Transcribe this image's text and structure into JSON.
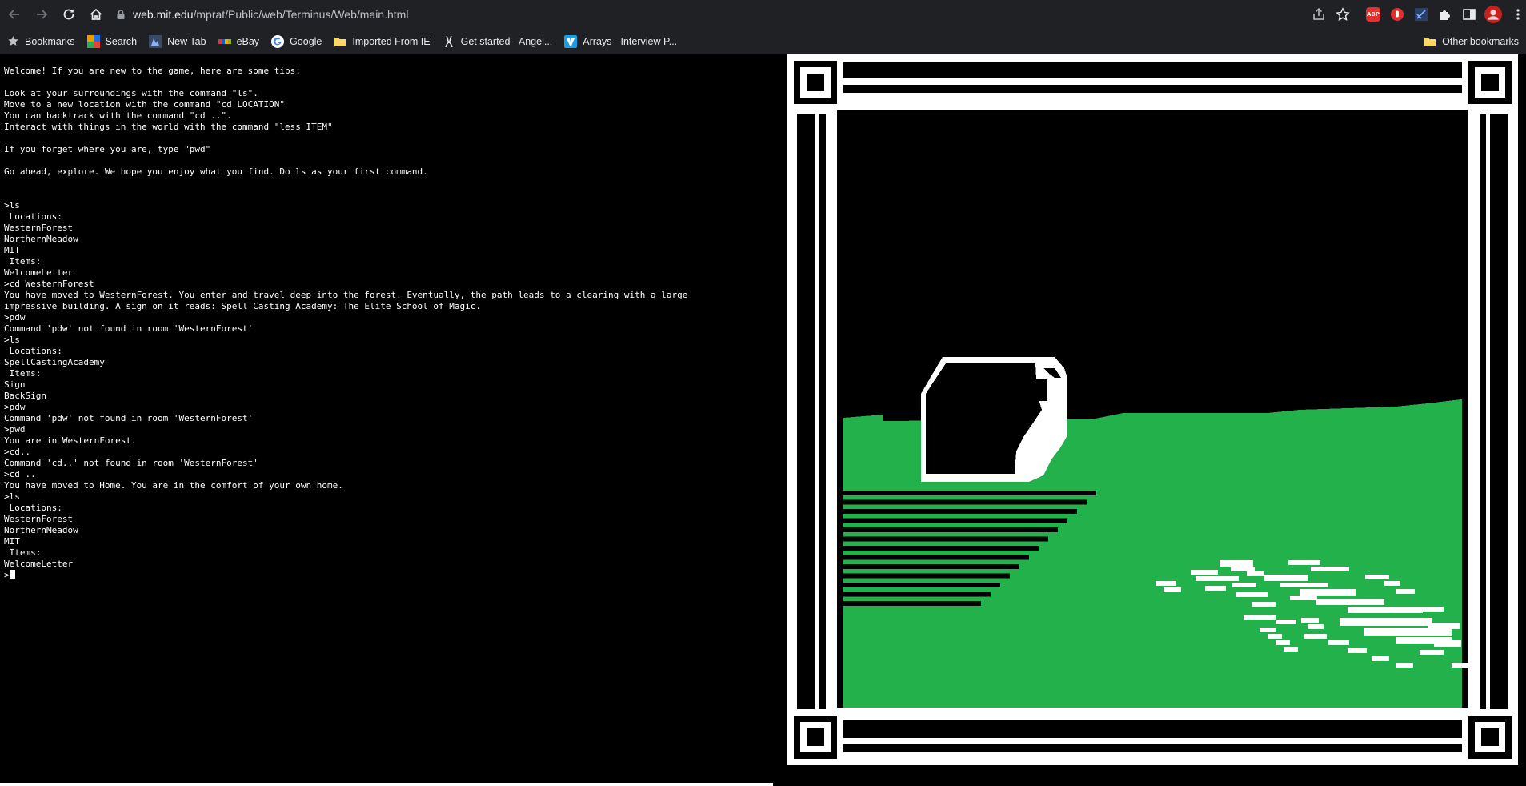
{
  "browser": {
    "url_host": "web.mit.edu",
    "url_path": "/mprat/Public/web/Terminus/Web/main.html",
    "nav_icons": [
      "back-icon",
      "forward-icon",
      "reload-icon",
      "home-icon"
    ],
    "right_icons": [
      "share-icon",
      "star-icon",
      "adblock-icon",
      "pause-icon",
      "extension-icon",
      "puzzle-icon",
      "sidepanel-icon",
      "profile-icon"
    ],
    "adblock_label": "ABP"
  },
  "bookmarks": [
    {
      "label": "Bookmarks",
      "icon": "star-icon"
    },
    {
      "label": "Search",
      "icon": "search-site-icon"
    },
    {
      "label": "New Tab",
      "icon": "newtab-icon"
    },
    {
      "label": "eBay",
      "icon": "ebay-icon"
    },
    {
      "label": "Google",
      "icon": "google-icon"
    },
    {
      "label": "Imported From IE",
      "icon": "folder-icon"
    },
    {
      "label": "Get started - Angel...",
      "icon": "angel-icon"
    },
    {
      "label": "Arrays - Interview P...",
      "icon": "interview-icon"
    }
  ],
  "other_bookmarks": "Other bookmarks",
  "terminal": {
    "lines": [
      {
        "t": "Welcome! If you are new to the game, here are some tips:"
      },
      {
        "t": ""
      },
      {
        "t": "Look at your surroundings with the command \"ls\"."
      },
      {
        "t": "Move to a new location with the command \"cd LOCATION\""
      },
      {
        "t": "You can backtrack with the command \"cd ..\"."
      },
      {
        "t": "Interact with things in the world with the command \"less ITEM\""
      },
      {
        "t": ""
      },
      {
        "t": "If you forget where you are, type \"pwd\""
      },
      {
        "t": ""
      },
      {
        "t": "Go ahead, explore. We hope you enjoy what you find. Do ls as your first command."
      },
      {
        "t": ""
      },
      {
        "t": ""
      },
      {
        "t": ">ls"
      },
      {
        "t": " Locations:"
      },
      {
        "t": "WesternForest"
      },
      {
        "t": "NorthernMeadow"
      },
      {
        "t": "MIT"
      },
      {
        "t": " Items:"
      },
      {
        "t": "WelcomeLetter"
      },
      {
        "t": ">cd WesternForest"
      },
      {
        "t": "You have moved to WesternForest. You enter and travel deep into the forest. Eventually, the path leads to a clearing with a large"
      },
      {
        "t": "impressive building. A sign on it reads: Spell Casting Academy: The Elite School of Magic."
      },
      {
        "t": ">pdw"
      },
      {
        "t": "Command 'pdw' not found in room 'WesternForest'"
      },
      {
        "t": ">ls"
      },
      {
        "t": " Locations:"
      },
      {
        "t": "SpellCastingAcademy"
      },
      {
        "t": " Items:"
      },
      {
        "t": "Sign"
      },
      {
        "t": "BackSign"
      },
      {
        "t": ">pdw"
      },
      {
        "t": "Command 'pdw' not found in room 'WesternForest'"
      },
      {
        "t": ">pwd"
      },
      {
        "t": "You are in WesternForest."
      },
      {
        "t": ">cd.."
      },
      {
        "t": "Command 'cd..' not found in room 'WesternForest'"
      },
      {
        "t": ">cd .."
      },
      {
        "t": "You have moved to Home. You are in the comfort of your own home."
      },
      {
        "t": ">ls"
      },
      {
        "t": " Locations:"
      },
      {
        "t": "WesternForest"
      },
      {
        "t": "NorthernMeadow"
      },
      {
        "t": "MIT"
      },
      {
        "t": " Items:"
      },
      {
        "t": "WelcomeLetter"
      }
    ],
    "prompt": ">",
    "current_input": ""
  },
  "art": {
    "colors": {
      "grass": "#23b14c",
      "frame": "#ffffff",
      "sky": "#000000"
    }
  }
}
